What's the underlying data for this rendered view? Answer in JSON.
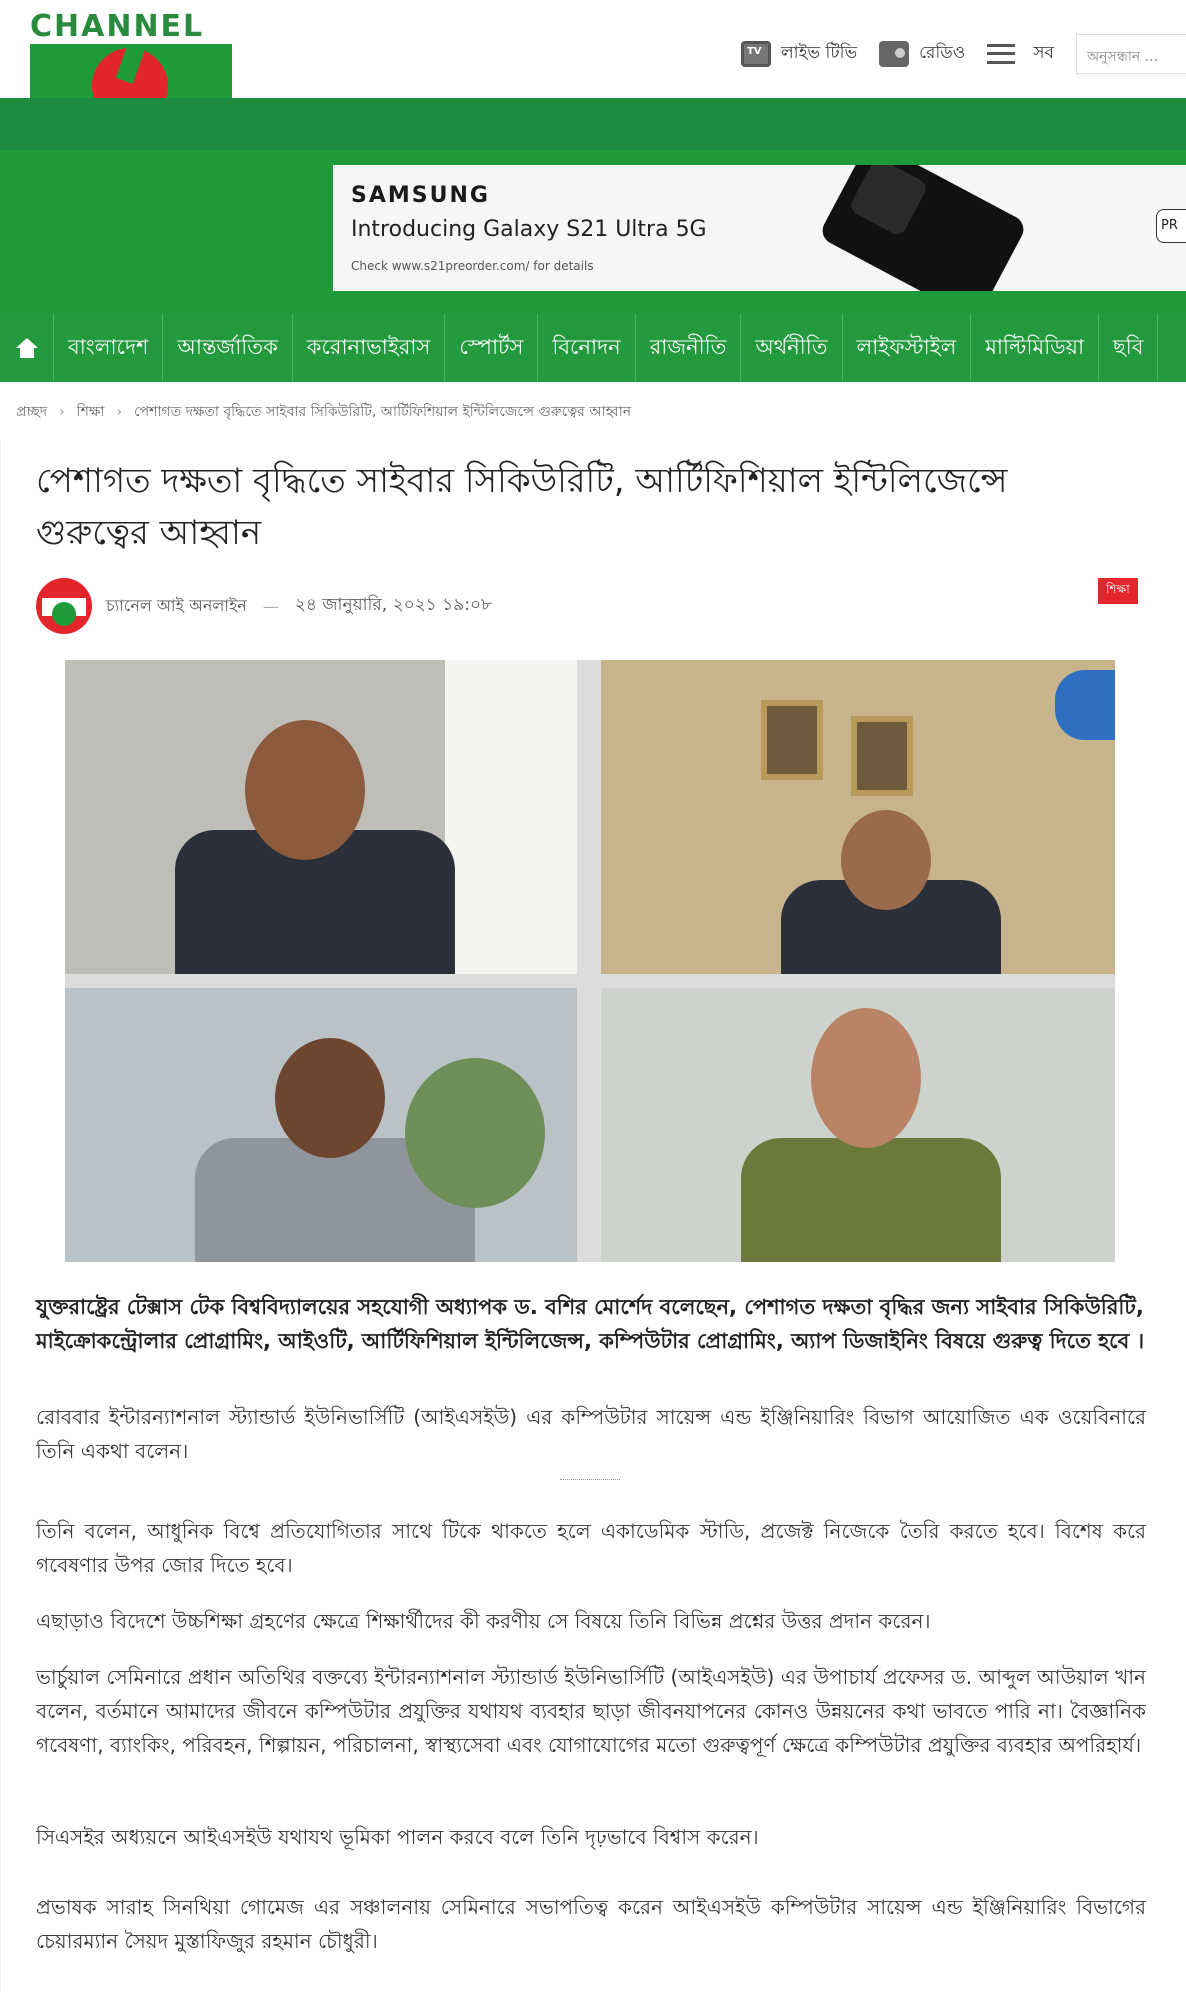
{
  "header": {
    "logo_text": "CHANNEL",
    "live_tv": "লাইভ টিভি",
    "radio": "রেডিও",
    "all": "সব",
    "search_placeholder": "অনুসন্ধান ..."
  },
  "ad": {
    "brand": "SAMSUNG",
    "headline": "Introducing Galaxy S21 Ultra 5G",
    "small": "Check www.s21preorder.com/ for details",
    "button": "PR"
  },
  "nav": {
    "items": [
      "বাংলাদেশ",
      "আন্তর্জাতিক",
      "করোনাভাইরাস",
      "স্পোর্টস",
      "বিনোদন",
      "রাজনীতি",
      "অর্থনীতি",
      "লাইফস্টাইল",
      "মাল্টিমিডিয়া",
      "ছবি"
    ]
  },
  "breadcrumb": {
    "home": "প্রচ্ছদ",
    "section": "শিক্ষা",
    "current": "পেশাগত দক্ষতা বৃদ্ধিতে সাইবার সিকিউরিটি, আর্টিফিশিয়াল ইন্টিলিজেন্সে গুরুত্বের আহ্বান",
    "sep": "›"
  },
  "article": {
    "title": "পেশাগত দক্ষতা বৃদ্ধিতে সাইবার সিকিউরিটি, আর্টিফিশিয়াল ইন্টিলিজেন্সে গুরুত্বের আহ্বান",
    "author": "চ্যানেল আই অনলাইন",
    "dash": "—",
    "date": "২৪ জানুয়ারি, ২০২১ ১৯:০৮",
    "category": "শিক্ষা",
    "lead": "যুক্তরাষ্ট্রের টেক্সাস টেক বিশ্ববিদ্যালয়ের সহযোগী অধ্যাপক ড. বশির মোর্শেদ বলেছেন, পেশাগত দক্ষতা বৃদ্ধির জন্য সাইবার সিকিউরিটি, মাইক্রোকন্ট্রোলার প্রোগ্রামিং, আইওটি, আর্টিফিশিয়াল ইন্টিলিজেন্স, কম্পিউটার প্রোগ্রামিং, অ্যাপ ডিজাইনিং বিষয়ে গুরুত্ব দিতে হবে ।",
    "paragraphs": [
      "রোববার ইন্টারন্যাশনাল স্ট্যান্ডার্ড ইউনিভার্সিটি (আইএসইউ) এর কম্পিউটার সায়েন্স এন্ড ইঞ্জিনিয়ারিং বিভাগ আয়োজিত এক ওয়েবিনারে তিনি একথা বলেন।",
      "তিনি বলেন, আধুনিক বিশ্বে প্রতিযোগিতার সাথে টিকে থাকতে হলে একাডেমিক স্টাডি, প্রজেক্ট  নিজেকে তৈরি করতে হবে। বিশেষ করে গবেষণার উপর জোর দিতে হবে।",
      "এছাড়াও বিদেশে উচ্চশিক্ষা গ্রহণের ক্ষেত্রে শিক্ষার্থীদের কী করণীয় সে বিষয়ে তিনি বিভিন্ন প্রশ্নের উত্তর প্রদান করেন।",
      "ভার্চুয়াল সেমিনারে প্রধান অতিথির বক্তব্যে ইন্টারন্যাশনাল স্ট্যান্ডার্ড ইউনিভার্সিটি (আইএসইউ) এর উপাচার্য প্রফেসর ড. আব্দুল আউয়াল খান বলেন, বর্তমানে আমাদের জীবনে কম্পিউটার প্রযুক্তির যথাযথ ব্যবহার ছাড়া জীবনযাপনের কোনও উন্নয়নের কথা ভাবতে পারি না। বৈজ্ঞানিক গবেষণা, ব্যাংকিং, পরিবহন, শিল্পায়ন, পরিচালনা, স্বাস্থ্যসেবা এবং যোগাযোগের মতো গুরুত্বপূর্ণ ক্ষেত্রে কম্পিউটার প্রযুক্তির ব্যবহার অপরিহার্য।",
      "সিএসইর অধ্যয়নে আইএসইউ যথাযথ ভূমিকা পালন করবে বলে তিনি দৃঢ়ভাবে বিশ্বাস করেন।",
      "প্রভাষক সারাহ সিনথিয়া গোমেজ এর সঞ্চালনায় সেমিনারে  সভাপতিত্ব করেন আইএসইউ কম্পিউটার সায়েন্স এন্ড ইঞ্জিনিয়ারিং বিভাগের চেয়ারম্যান সৈয়দ মুস্তাফিজুর রহমান চৌধুরী।"
    ]
  },
  "colors": {
    "brand_green": "#239a3e",
    "brand_red": "#e3262b"
  }
}
